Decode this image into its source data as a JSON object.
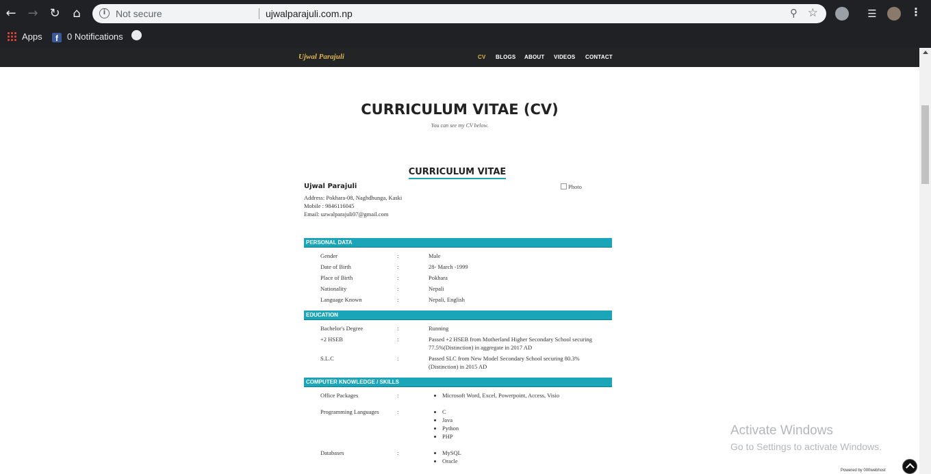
{
  "browser": {
    "security_label": "Not secure",
    "url": "ujwalparajuli.com.np",
    "bookmarks": [
      {
        "label": "Apps"
      },
      {
        "label": "0 Notifications"
      }
    ]
  },
  "site": {
    "logo": "Ujwal Parajuli",
    "nav": [
      "CV",
      "BLOGS",
      "ABOUT",
      "VIDEOS",
      "CONTACT"
    ]
  },
  "page": {
    "title": "CURRICULUM VITAE (CV)",
    "subtitle": "You can see my CV below."
  },
  "cv": {
    "heading": "CURRICULUM VITAE",
    "name": "Ujwal Parajuli",
    "address": "Address: Pokhara-08, Naghdhunga, Kaski",
    "mobile": "Mobile : 9846116045",
    "email": "Email: uzwalparajuli07@gmail.com",
    "photo_alt": "Photo",
    "sections": {
      "personal": {
        "title": "PERSONAL DATA",
        "rows": [
          {
            "k": "Gender",
            "v": "Male"
          },
          {
            "k": "Date of Birth",
            "v": "28- March -1999"
          },
          {
            "k": "Place of Birth",
            "v": "Pokhara"
          },
          {
            "k": "Nationality",
            "v": "Nepali"
          },
          {
            "k": "Language Known",
            "v": "Nepali, English"
          }
        ]
      },
      "education": {
        "title": "EDUCATION",
        "rows": [
          {
            "k": "Bachelor's Degree",
            "v": "Running"
          },
          {
            "k": "+2 HSEB",
            "v": "Passed +2 HSEB from Motherland Higher Secondary School securing 77.5%(Distinction) in aggregate in 2017 AD"
          },
          {
            "k": "S.L.C",
            "v": "Passed SLC from New Model Secondary School securing 80.3%(Distinction) in 2015 AD"
          }
        ]
      },
      "skills": {
        "title": "COMPUTER KNOWLEDGE / SKILLS",
        "rows": [
          {
            "k": "Office Packages",
            "items": [
              "Microsoft Word, Excel, Powerpoint, Access, Visio"
            ]
          },
          {
            "k": "Programming Languages",
            "items": [
              "C",
              "Java",
              "Python",
              "PHP"
            ]
          },
          {
            "k": "Databases",
            "items": [
              "MySQL",
              "Oracle"
            ]
          }
        ]
      }
    },
    "colon": ":"
  },
  "overlay": {
    "activate_title": "Activate Windows",
    "activate_sub": "Go to Settings to activate Windows.",
    "powered": "Powered by 000webhost"
  }
}
